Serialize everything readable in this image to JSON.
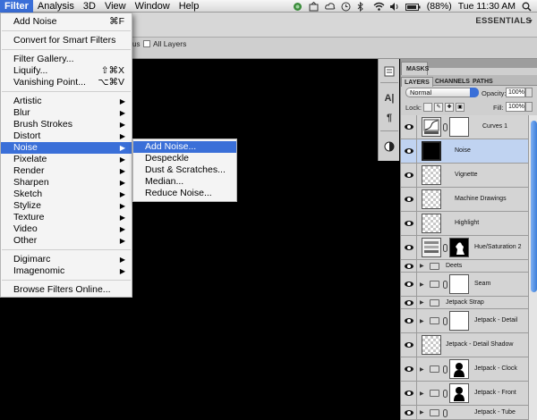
{
  "menubar": {
    "items": [
      "Filter",
      "Analysis",
      "3D",
      "View",
      "Window",
      "Help"
    ],
    "battery": "(88%)",
    "clock": "Tue 11:30 AM"
  },
  "workspace": {
    "essentials": "ESSENTIALS"
  },
  "options": {
    "all_layers": "All Layers",
    "prefix": "us"
  },
  "filter_menu": {
    "last_filter": "Add Noise",
    "last_filter_shortcut": "⌘F",
    "convert": "Convert for Smart Filters",
    "gallery": "Filter Gallery...",
    "liquify": "Liquify...",
    "liquify_shortcut": "⇧⌘X",
    "vanishing": "Vanishing Point...",
    "vanishing_shortcut": "⌥⌘V",
    "categories": [
      "Artistic",
      "Blur",
      "Brush Strokes",
      "Distort",
      "Noise",
      "Pixelate",
      "Render",
      "Sharpen",
      "Sketch",
      "Stylize",
      "Texture",
      "Video",
      "Other"
    ],
    "plugins": [
      "Digimarc",
      "Imagenomic"
    ],
    "browse": "Browse Filters Online..."
  },
  "noise_submenu": [
    "Add Noise...",
    "Despeckle",
    "Dust & Scratches...",
    "Median...",
    "Reduce Noise..."
  ],
  "panels": {
    "masks_tab": "MASKS",
    "tabs": [
      "LAYERS",
      "CHANNELS",
      "PATHS"
    ],
    "blend_mode": "Normal",
    "opacity_label": "Opacity:",
    "opacity": "100%",
    "lock_label": "Lock:",
    "fill_label": "Fill:",
    "fill": "100%"
  },
  "layers": [
    {
      "name": "Curves 1"
    },
    {
      "name": "Noise"
    },
    {
      "name": "Vignette"
    },
    {
      "name": "Machine Drawings"
    },
    {
      "name": "Highlight"
    },
    {
      "name": "Hue/Saturation 2"
    },
    {
      "name": "Deets"
    },
    {
      "name": "Seam"
    },
    {
      "name": "Jetpack Strap"
    },
    {
      "name": "Jetpack - Detail"
    },
    {
      "name": "Jetpack - Detail Shadow"
    },
    {
      "name": "Jetpack - Clock"
    },
    {
      "name": "Jetpack - Front"
    },
    {
      "name": "Jetpack - Tube"
    }
  ],
  "colors": {
    "highlight": "#3a6fd8",
    "selected_layer": "#c0d3f1"
  }
}
